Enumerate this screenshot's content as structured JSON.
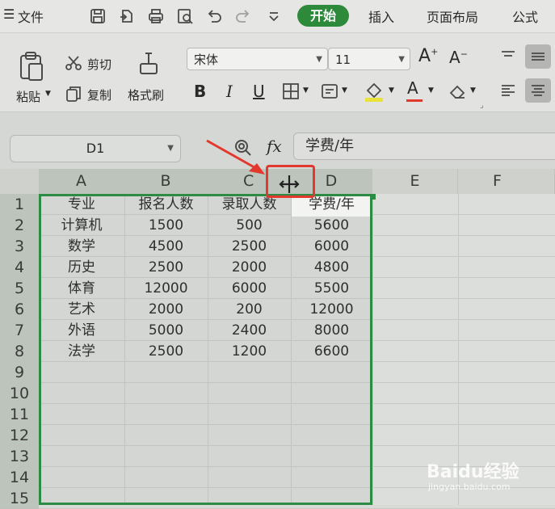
{
  "menubar": {
    "file_label": "文件",
    "tabs": [
      "开始",
      "插入",
      "页面布局",
      "公式"
    ]
  },
  "ribbon": {
    "paste_label": "粘贴",
    "cut_label": "剪切",
    "copy_label": "复制",
    "format_painter_label": "格式刷",
    "font_name": "宋体",
    "font_size": "11",
    "bold": "B",
    "italic": "I",
    "underline": "U"
  },
  "formula_bar": {
    "name_box": "D1",
    "fx_label": "fx",
    "formula": "学费/年"
  },
  "sheet": {
    "columns": [
      "A",
      "B",
      "C",
      "D",
      "E",
      "F"
    ],
    "rows": [
      "1",
      "2",
      "3",
      "4",
      "5",
      "6",
      "7",
      "8",
      "9",
      "10",
      "11",
      "12",
      "13",
      "14",
      "15"
    ],
    "data": [
      [
        "专业",
        "报名人数",
        "录取人数",
        "学费/年"
      ],
      [
        "计算机",
        "1500",
        "500",
        "5600"
      ],
      [
        "数学",
        "4500",
        "2500",
        "6000"
      ],
      [
        "历史",
        "2500",
        "2000",
        "4800"
      ],
      [
        "体育",
        "12000",
        "6000",
        "5500"
      ],
      [
        "艺术",
        "2000",
        "200",
        "12000"
      ],
      [
        "外语",
        "5000",
        "2400",
        "8000"
      ],
      [
        "法学",
        "2500",
        "1200",
        "6600"
      ]
    ]
  },
  "watermark": {
    "text": "Baidu经验",
    "sub": "jingyan.baidu.com"
  },
  "colors": {
    "accent": "#2c8a3a",
    "selection": "#2e8b43",
    "annotation": "#e3382e"
  }
}
